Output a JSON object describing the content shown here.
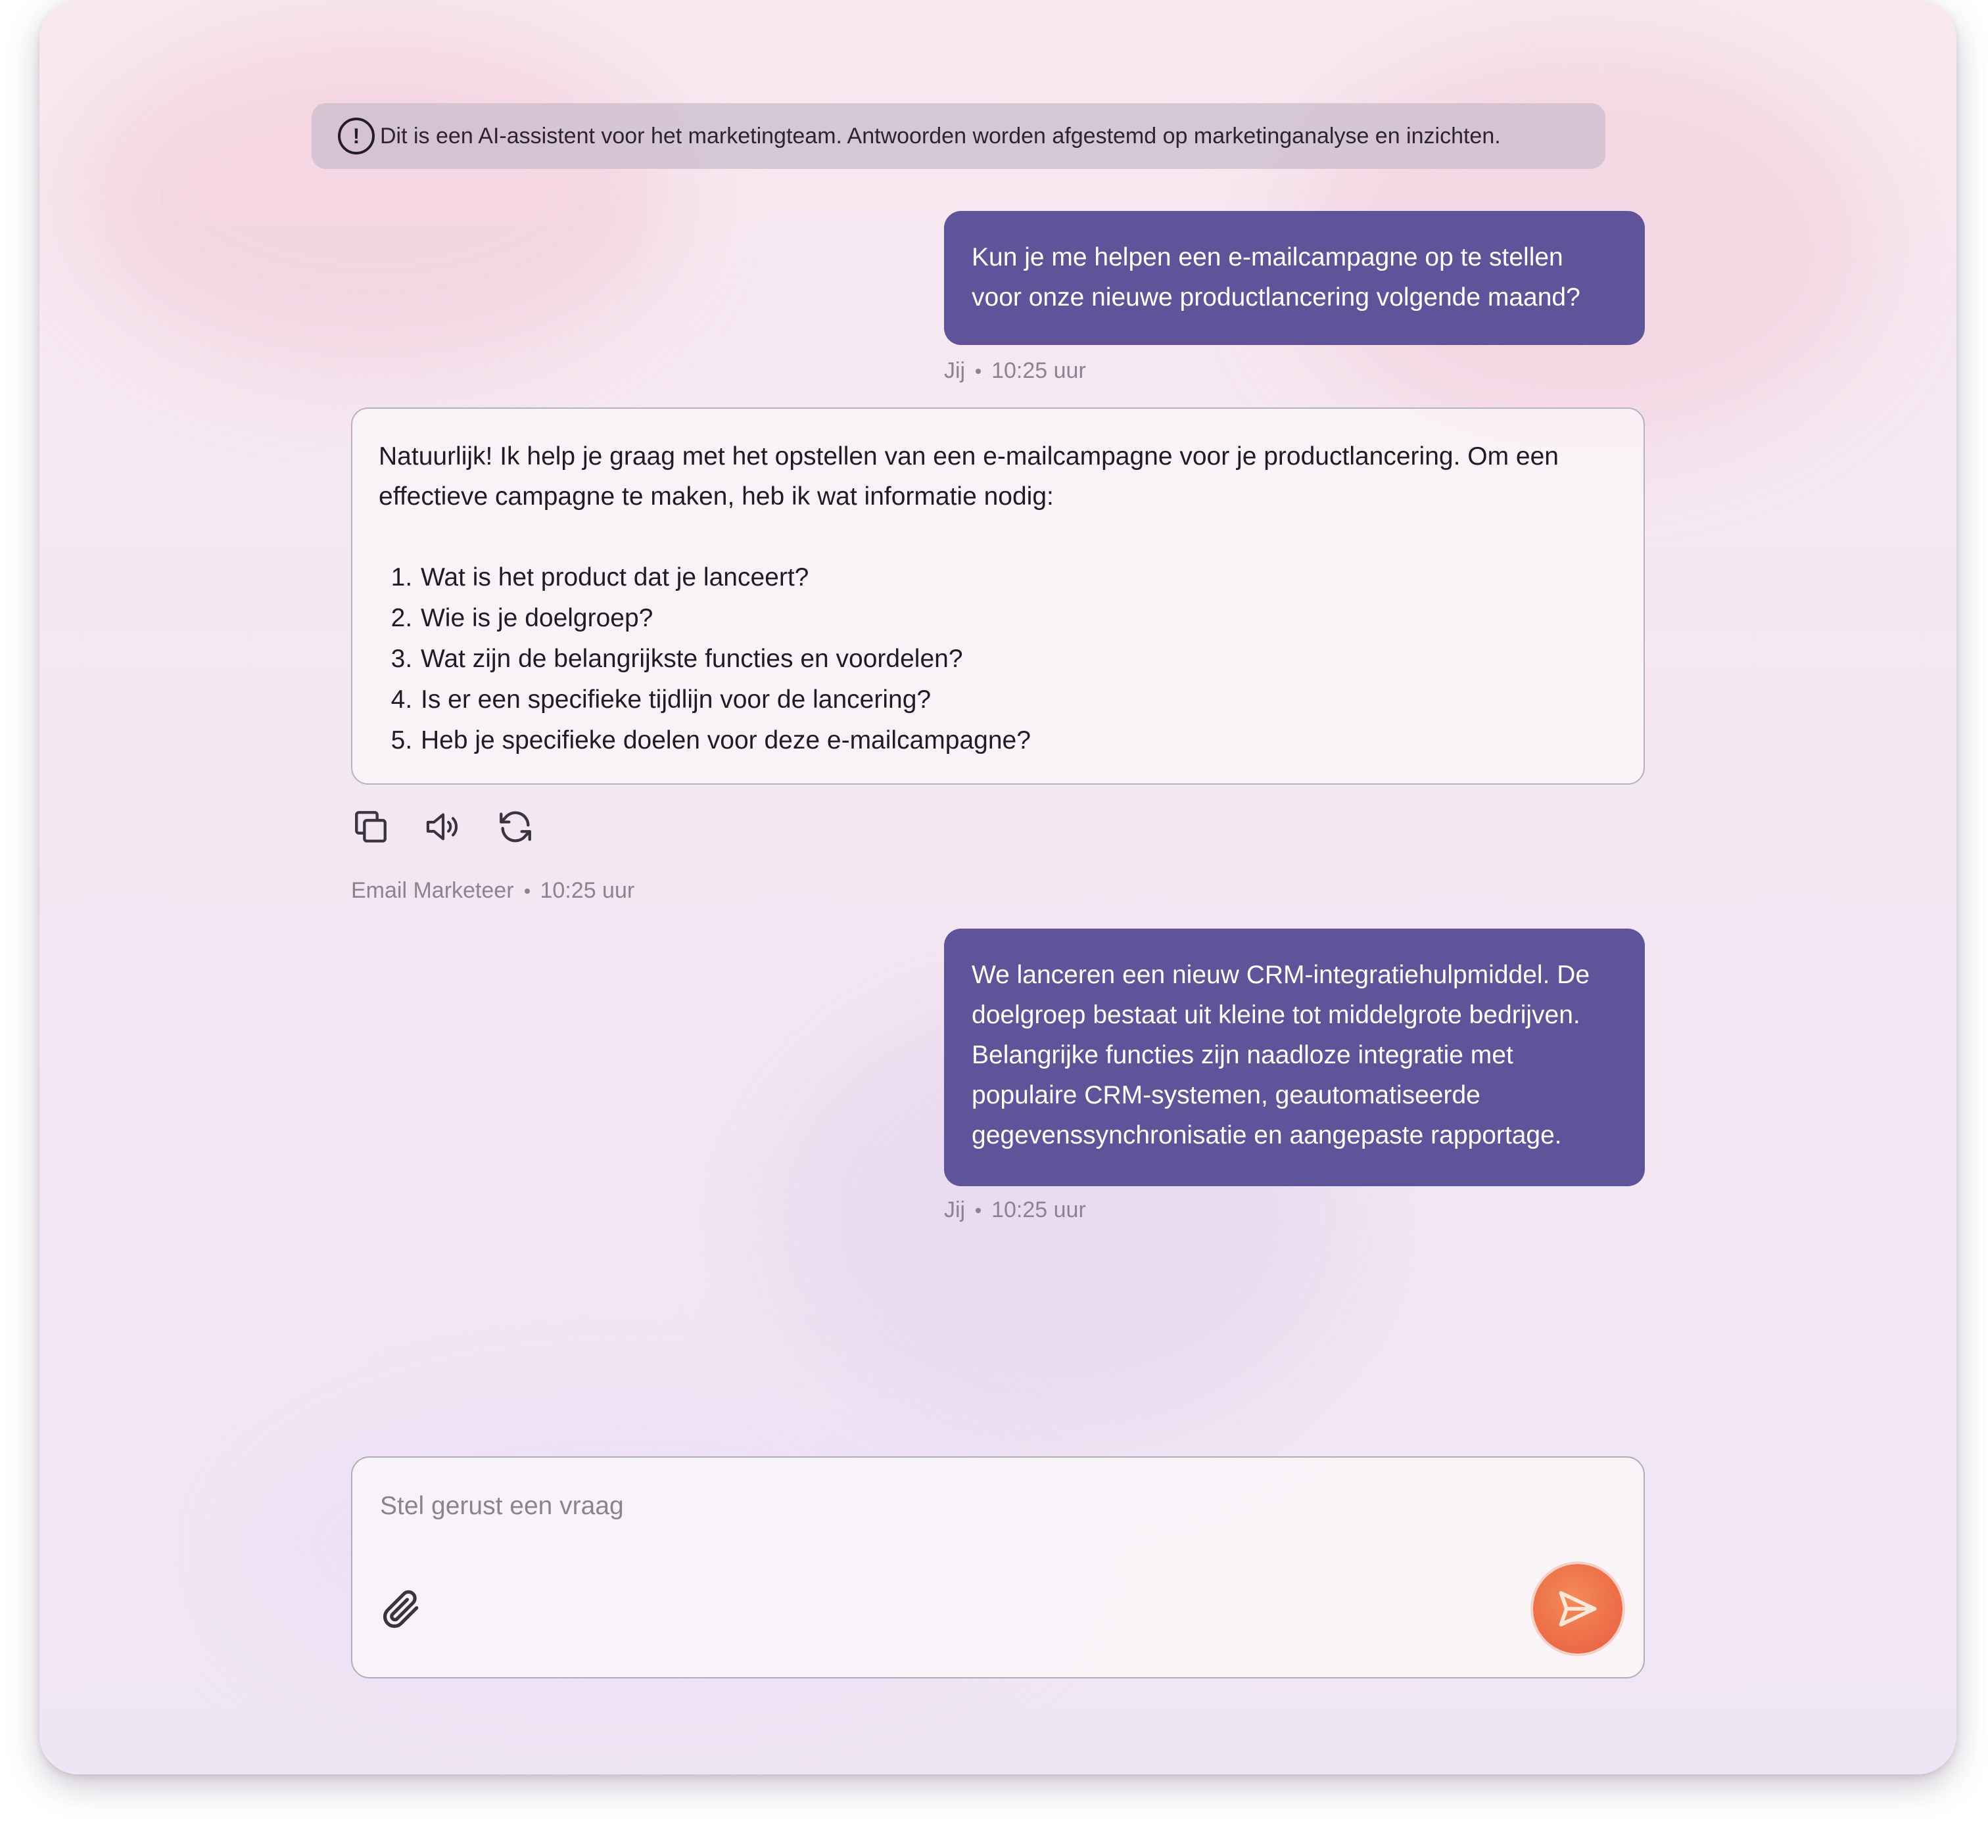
{
  "notice": {
    "text": "Dit is een AI-assistent voor het marketingteam. Antwoorden worden afgestemd op marketinganalyse en inzichten.",
    "icon": "alert-circle-icon"
  },
  "messages": [
    {
      "role": "user",
      "lines": [
        "Kun je me helpen een e-mailcampagne op te stellen",
        "voor onze nieuwe productlancering volgende maand?"
      ],
      "author": "Jij",
      "time": "10:25 uur"
    },
    {
      "role": "assistant",
      "intro": "Natuurlijk! Ik help je graag met het opstellen van een e-mailcampagne voor je productlancering. Om een effectieve campagne te maken, heb ik wat informatie nodig:",
      "items": [
        "Wat is het product dat je lanceert?",
        "Wie is je doelgroep?",
        "Wat zijn de belangrijkste functies en voordelen?",
        "Is er een specifieke tijdlijn voor de lancering?",
        "Heb je specifieke doelen voor deze e-mailcampagne?"
      ],
      "author": "Email Marketeer",
      "time": "10:25 uur"
    },
    {
      "role": "user",
      "lines": [
        "We lanceren een nieuw CRM-integratiehulpmiddel. De",
        "doelgroep bestaat uit kleine tot middelgrote bedrijven.",
        "Belangrijke functies zijn naadloze integratie met",
        "populaire CRM-systemen, geautomatiseerde",
        "gegevenssynchronisatie en aangepaste rapportage."
      ],
      "author": "Jij",
      "time": "10:25 uur"
    }
  ],
  "actions": [
    "copy-icon",
    "speaker-icon",
    "refresh-icon"
  ],
  "composer": {
    "placeholder": "Stel gerust een vraag",
    "attach_icon": "paperclip-icon",
    "send_icon": "send-icon"
  },
  "colors": {
    "user_bubble": "#5f5399",
    "send_button": "#ec6a45"
  }
}
